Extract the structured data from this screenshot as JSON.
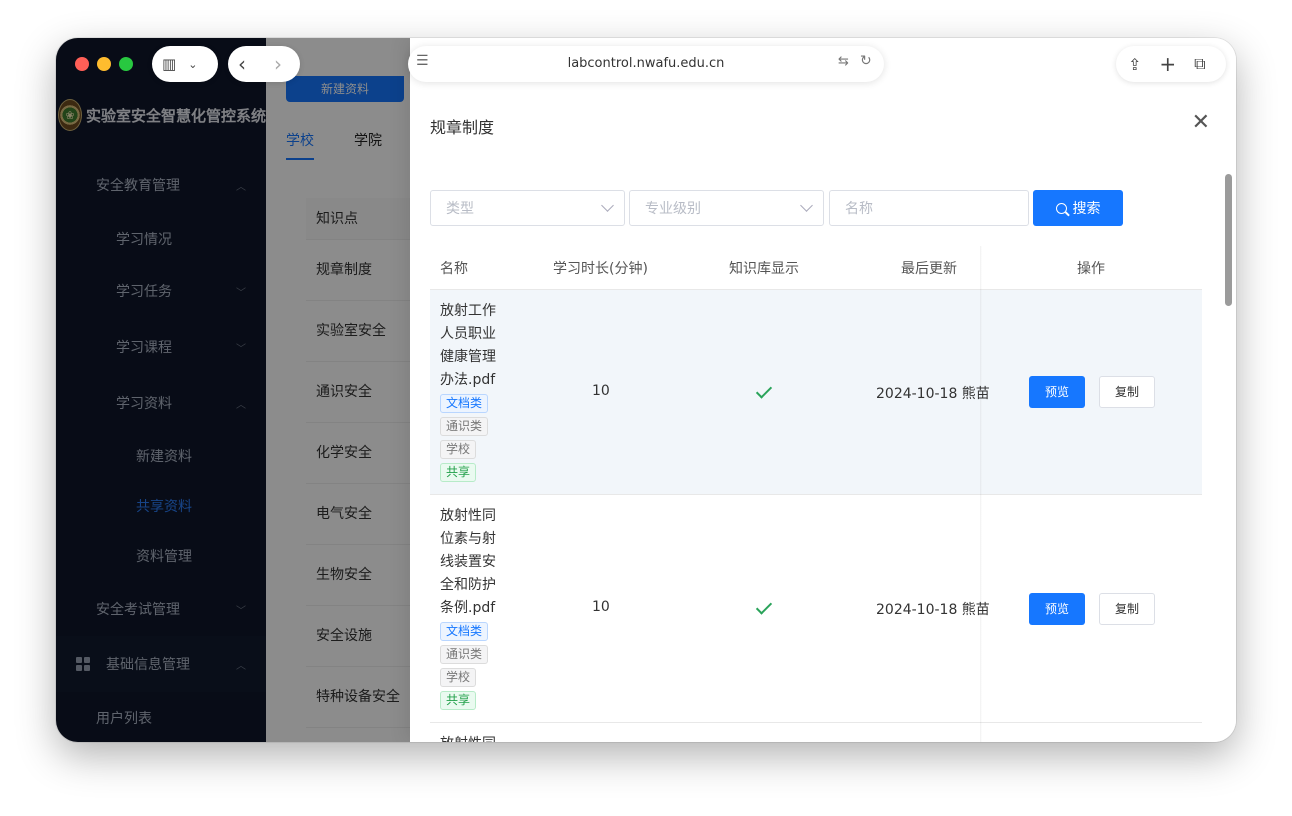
{
  "browser": {
    "url": "labcontrol.nwafu.edu.cn"
  },
  "app": {
    "title": "实验室安全智慧化管控系统",
    "top_button": "新建资料",
    "tabs": [
      "学校",
      "学院"
    ],
    "knowledge_header": "知识点",
    "knowledge_items": [
      "规章制度",
      "实验室安全",
      "通识安全",
      "化学安全",
      "电气安全",
      "生物安全",
      "安全设施",
      "特种设备安全"
    ]
  },
  "sidebar": {
    "items": [
      {
        "label": "安全教育管理"
      },
      {
        "label": "学习情况"
      },
      {
        "label": "学习任务"
      },
      {
        "label": "学习课程"
      },
      {
        "label": "学习资料"
      },
      {
        "label": "新建资料"
      },
      {
        "label": "共享资料"
      },
      {
        "label": "资料管理"
      },
      {
        "label": "安全考试管理"
      },
      {
        "label": "基础信息管理"
      },
      {
        "label": "用户列表"
      }
    ]
  },
  "drawer": {
    "title": "规章制度",
    "filters": {
      "type_placeholder": "类型",
      "level_placeholder": "专业级别",
      "name_placeholder": "名称",
      "search_label": "搜索"
    },
    "columns": [
      "名称",
      "学习时长(分钟)",
      "知识库显示",
      "最后更新",
      "操作"
    ],
    "rows": [
      {
        "name": "放射工作人员职业健康管理办法.pdf",
        "tags": [
          "文档类",
          "通识类",
          "学校",
          "共享"
        ],
        "duration": "10",
        "updated": "2024-10-18 熊苗",
        "preview": "预览",
        "copy": "复制"
      },
      {
        "name": "放射性同位素与射线装置安全和防护条例.pdf",
        "tags": [
          "文档类",
          "通识类",
          "学校",
          "共享"
        ],
        "duration": "10",
        "updated": "2024-10-18 熊苗",
        "preview": "预览",
        "copy": "复制"
      },
      {
        "name": "放射性同"
      }
    ]
  },
  "colors": {
    "accent": "#1677ff",
    "sidebar_bg": "#0f172a",
    "check": "#2aa35a"
  }
}
